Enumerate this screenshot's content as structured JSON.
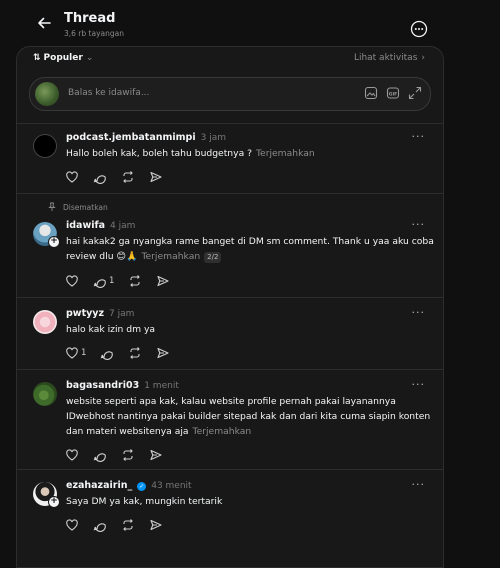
{
  "header": {
    "title": "Thread",
    "views": "3,6 rb tayangan"
  },
  "sortbar": {
    "sort_label": "Populer",
    "activity_label": "Lihat aktivitas"
  },
  "reply": {
    "placeholder": "Balas ke idawifa..."
  },
  "posts": [
    {
      "username": "podcast.jembatanmimpi",
      "time": "3 jam",
      "text": "Hallo boleh kak, boleh tahu budgetnya ?",
      "translate": "Terjemahkan",
      "likes": "",
      "replies": ""
    },
    {
      "pinned": "Disematkan",
      "username": "idawifa",
      "time": "4 jam",
      "text_line1": "hai kakak2 ga nyangka rame banget di DM sm comment. Thank u yaa aku coba",
      "text_line2": "review dlu 😊🙏",
      "translate": "Terjemahkan",
      "page": "2/2",
      "replies": "1"
    },
    {
      "username": "pwtyyz",
      "time": "7 jam",
      "text": "halo kak izin dm ya",
      "likes": "1"
    },
    {
      "username": "bagasandri03",
      "time": "1 menit",
      "text_line1": "website seperti apa kak, kalau website profile pernah pakai layanannya",
      "text_line2": "IDwebhost nantinya pakai builder sitepad kak dan dari kita cuma siapin konten",
      "text_line3": "dan materi websitenya aja",
      "translate": "Terjemahkan"
    },
    {
      "username": "ezahazairin_",
      "verified": true,
      "time": "43 menit",
      "text": "Saya DM ya kak, mungkin tertarik"
    }
  ],
  "colors": {
    "background": "#101010",
    "panel": "#181818",
    "verified": "#0095f6"
  }
}
